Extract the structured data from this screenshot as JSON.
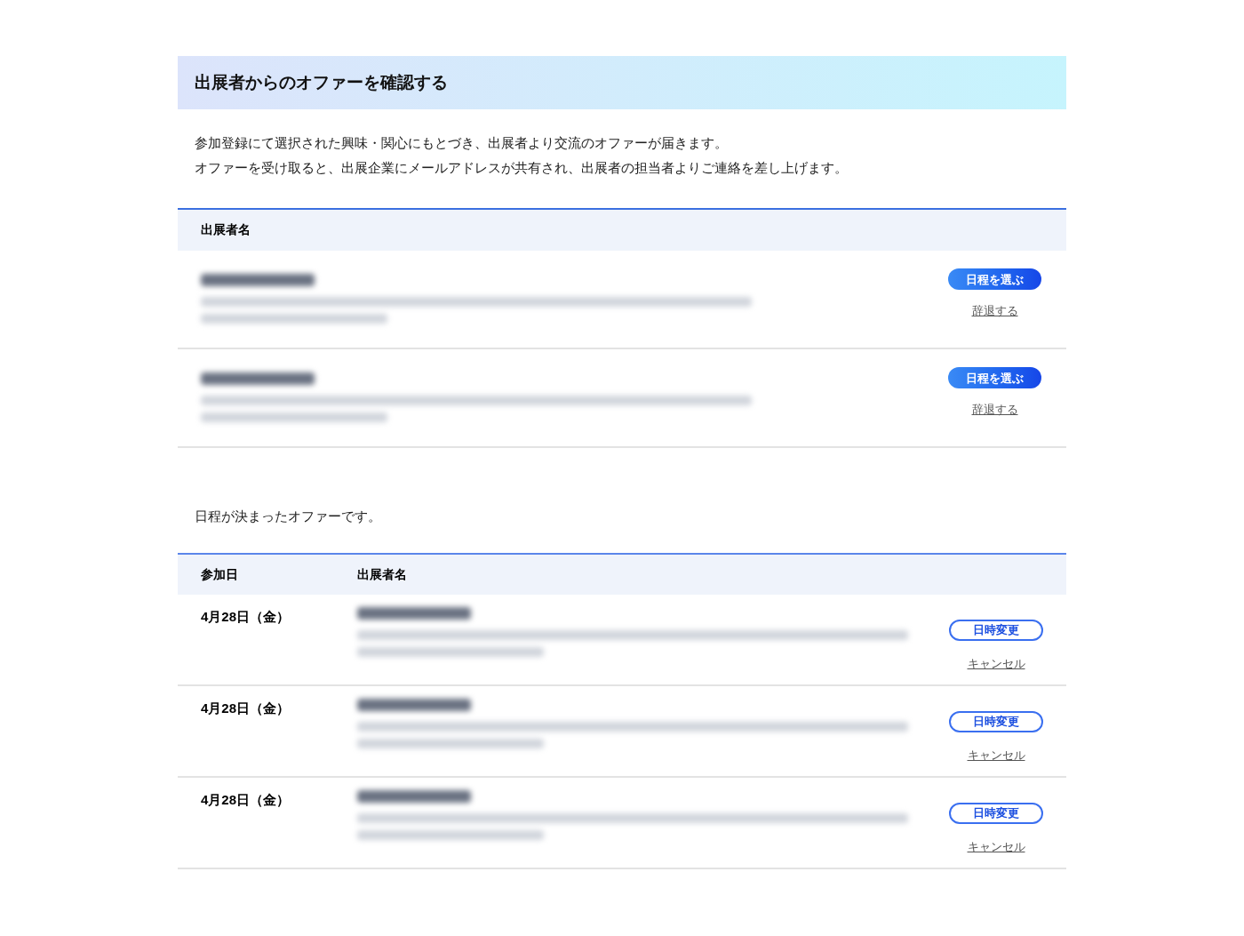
{
  "title": "出展者からのオファーを確認する",
  "intro": [
    "参加登録にて選択された興味・関心にもとづき、出展者より交流のオファーが届きます。",
    "オファーを受け取ると、出展企業にメールアドレスが共有され、出展者の担当者よりご連絡を差し上げます。"
  ],
  "offers": {
    "columns": [
      "出展者名"
    ],
    "rows": [
      {
        "primary_button": "日程を選ぶ",
        "decline_link": "辞退する"
      },
      {
        "primary_button": "日程を選ぶ",
        "decline_link": "辞退する"
      }
    ]
  },
  "scheduled_note": "日程が決まったオファーです。",
  "scheduled": {
    "columns": [
      "参加日",
      "出展者名"
    ],
    "rows": [
      {
        "date": "4月28日（金）",
        "change_button": "日時変更",
        "cancel_link": "キャンセル"
      },
      {
        "date": "4月28日（金）",
        "change_button": "日時変更",
        "cancel_link": "キャンセル"
      },
      {
        "date": "4月28日（金）",
        "change_button": "日時変更",
        "cancel_link": "キャンセル"
      }
    ]
  }
}
